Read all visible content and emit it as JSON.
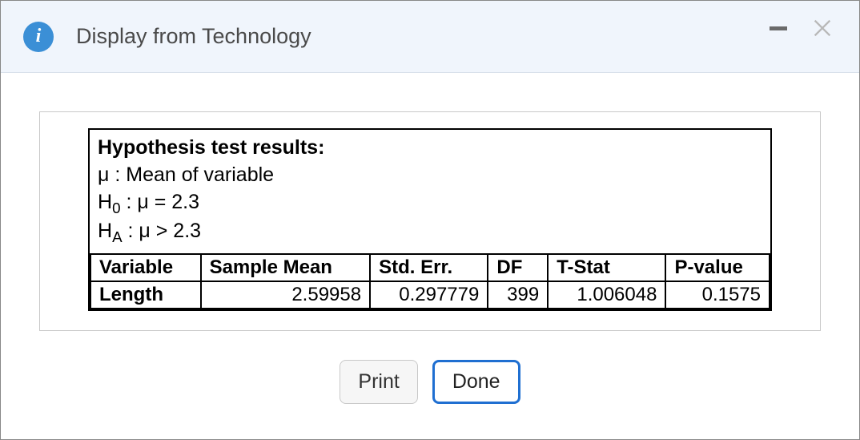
{
  "titlebar": {
    "title": "Display from Technology"
  },
  "results": {
    "heading": "Hypothesis test results:",
    "mu_line_prefix": "μ : ",
    "mu_line_text": "Mean of variable",
    "h0_label": "H",
    "h0_sub": "0",
    "h0_rest": " : μ = 2.3",
    "ha_label": "H",
    "ha_sub": "A",
    "ha_rest": " : μ > 2.3"
  },
  "table": {
    "headers": {
      "variable": "Variable",
      "sample_mean": "Sample Mean",
      "std_err": "Std. Err.",
      "df": "DF",
      "t_stat": "T-Stat",
      "p_value": "P-value"
    },
    "row": {
      "variable": "Length",
      "sample_mean": "2.59958",
      "std_err": "0.297779",
      "df": "399",
      "t_stat": "1.006048",
      "p_value": "0.1575"
    }
  },
  "buttons": {
    "print": "Print",
    "done": "Done"
  }
}
